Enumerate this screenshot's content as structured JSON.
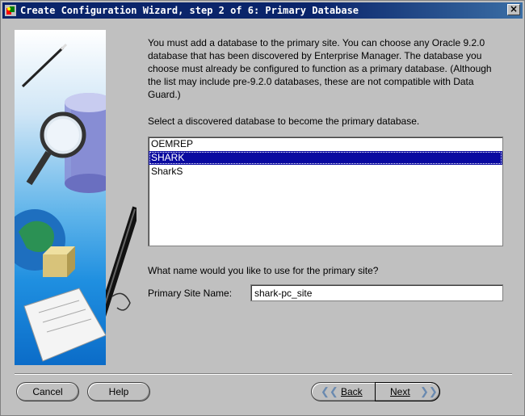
{
  "window": {
    "title": "Create Configuration Wizard, step 2 of 6: Primary Database",
    "close_glyph": "×"
  },
  "description": "You must add a database to the primary site. You can choose any Oracle 9.2.0 database that has been discovered by Enterprise Manager. The database you choose must already be configured to function as a primary database. (Although the list may include pre-9.2.0 databases, these are not compatible with Data Guard.)",
  "select_label": "Select a discovered database to become the primary database.",
  "databases": {
    "items": [
      "OEMREP",
      "SHARK",
      "SharkS"
    ],
    "selected": "SHARK"
  },
  "site_question": "What name would you like to use for the primary site?",
  "site_name": {
    "label": "Primary Site Name:",
    "value": "shark-pc_site"
  },
  "buttons": {
    "cancel": "Cancel",
    "help": "Help",
    "back": "Back",
    "next": "Next"
  },
  "icons": [
    "wizard-icon",
    "database-magnifier-illustration",
    "globe-illustration",
    "pen-illustration",
    "back-arrow-icon",
    "next-arrow-icon"
  ]
}
